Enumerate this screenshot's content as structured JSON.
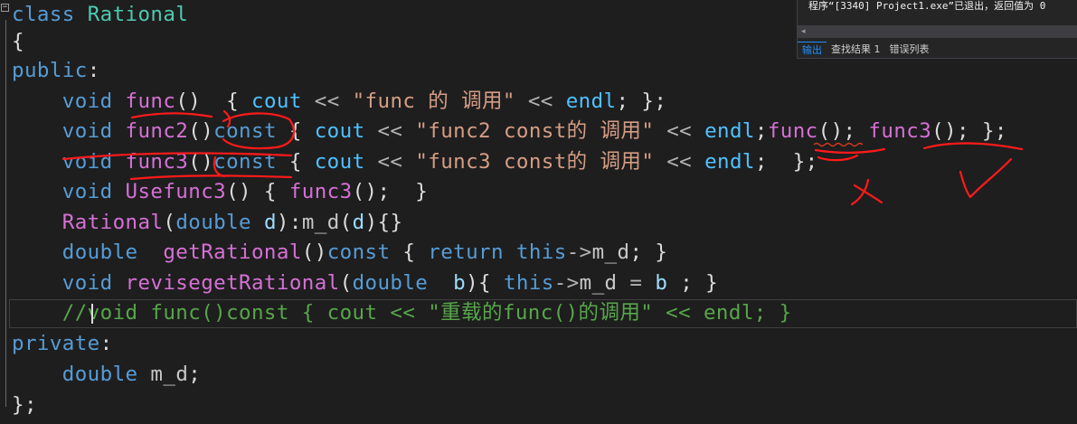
{
  "editor": {
    "lines": [
      [
        {
          "t": "class ",
          "c": "kw"
        },
        {
          "t": "Rational",
          "c": "cls"
        }
      ],
      [
        {
          "t": "{",
          "c": "pl"
        }
      ],
      [
        {
          "t": "public",
          "c": "kw"
        },
        {
          "t": ":",
          "c": "pl"
        }
      ],
      [
        {
          "t": "    void ",
          "c": "kw"
        },
        {
          "t": "func",
          "c": "fnm"
        },
        {
          "t": "()  ",
          "c": "pl"
        },
        {
          "t": "{ ",
          "c": "pl"
        },
        {
          "t": "cout",
          "c": "cout"
        },
        {
          "t": " << ",
          "c": "op"
        },
        {
          "t": "\"func 的 调用\"",
          "c": "str"
        },
        {
          "t": " << ",
          "c": "op"
        },
        {
          "t": "endl",
          "c": "endl"
        },
        {
          "t": "; };",
          "c": "pl"
        }
      ],
      [
        {
          "t": "    void ",
          "c": "kw"
        },
        {
          "t": "func2",
          "c": "fnm"
        },
        {
          "t": "()",
          "c": "pl"
        },
        {
          "t": "const",
          "c": "kw"
        },
        {
          "t": " { ",
          "c": "pl"
        },
        {
          "t": "cout",
          "c": "cout"
        },
        {
          "t": " << ",
          "c": "op"
        },
        {
          "t": "\"func2 const的 调用\"",
          "c": "str"
        },
        {
          "t": " << ",
          "c": "op"
        },
        {
          "t": "endl",
          "c": "endl"
        },
        {
          "t": ";",
          "c": "pl"
        },
        {
          "t": "func",
          "c": "fnm"
        },
        {
          "t": "(); ",
          "c": "pl"
        },
        {
          "t": "func3",
          "c": "fnm"
        },
        {
          "t": "(); };",
          "c": "pl"
        }
      ],
      [
        {
          "t": "    void ",
          "c": "kw"
        },
        {
          "t": "func3",
          "c": "fnm"
        },
        {
          "t": "()",
          "c": "pl"
        },
        {
          "t": "const",
          "c": "kw"
        },
        {
          "t": " { ",
          "c": "pl"
        },
        {
          "t": "cout",
          "c": "cout"
        },
        {
          "t": " << ",
          "c": "op"
        },
        {
          "t": "\"func3 const的 调用\"",
          "c": "str"
        },
        {
          "t": " << ",
          "c": "op"
        },
        {
          "t": "endl",
          "c": "endl"
        },
        {
          "t": ";  };",
          "c": "pl"
        }
      ],
      [
        {
          "t": "    void ",
          "c": "kw"
        },
        {
          "t": "Usefunc3",
          "c": "fnm"
        },
        {
          "t": "() { ",
          "c": "pl"
        },
        {
          "t": "func3",
          "c": "fnm"
        },
        {
          "t": "();  }",
          "c": "pl"
        }
      ],
      [
        {
          "t": "    ",
          "c": "pl"
        },
        {
          "t": "Rational",
          "c": "fnm"
        },
        {
          "t": "(",
          "c": "pl"
        },
        {
          "t": "double ",
          "c": "kw"
        },
        {
          "t": "d",
          "c": "par"
        },
        {
          "t": "):",
          "c": "pl"
        },
        {
          "t": "m_d",
          "c": "vr"
        },
        {
          "t": "(",
          "c": "pl"
        },
        {
          "t": "d",
          "c": "par"
        },
        {
          "t": "){}",
          "c": "pl"
        }
      ],
      [
        {
          "t": "    double  ",
          "c": "kw"
        },
        {
          "t": "getRational",
          "c": "fnm"
        },
        {
          "t": "()",
          "c": "pl"
        },
        {
          "t": "const",
          "c": "kw"
        },
        {
          "t": " { ",
          "c": "pl"
        },
        {
          "t": "return ",
          "c": "kw"
        },
        {
          "t": "this",
          "c": "kw"
        },
        {
          "t": "->",
          "c": "op"
        },
        {
          "t": "m_d",
          "c": "vr"
        },
        {
          "t": "; }",
          "c": "pl"
        }
      ],
      [
        {
          "t": "    void ",
          "c": "kw"
        },
        {
          "t": "revisegetRational",
          "c": "fnm"
        },
        {
          "t": "(",
          "c": "pl"
        },
        {
          "t": "double  ",
          "c": "kw"
        },
        {
          "t": "b",
          "c": "par"
        },
        {
          "t": "){ ",
          "c": "pl"
        },
        {
          "t": "this",
          "c": "kw"
        },
        {
          "t": "->",
          "c": "op"
        },
        {
          "t": "m_d",
          "c": "vr"
        },
        {
          "t": " = ",
          "c": "op"
        },
        {
          "t": "b",
          "c": "par"
        },
        {
          "t": " ; }",
          "c": "pl"
        }
      ],
      [
        {
          "t": "    //void func()const { cout << \"重载的func()的调用\" << endl; }",
          "c": "cmt"
        }
      ],
      [
        {
          "t": "private",
          "c": "kw"
        },
        {
          "t": ":",
          "c": "pl"
        }
      ],
      [
        {
          "t": "    double ",
          "c": "kw"
        },
        {
          "t": "m_d",
          "c": "vr"
        },
        {
          "t": ";",
          "c": "pl"
        }
      ],
      [
        {
          "t": "};",
          "c": "pl"
        }
      ]
    ]
  },
  "output_panel": {
    "message": "程序“[3340] Project1.exe”已退出，返回值为 0",
    "scroll_left_glyph": "◂",
    "tabs": [
      {
        "label": "输出",
        "active": true
      },
      {
        "label": "查找结果 1",
        "active": false
      },
      {
        "label": "错误列表",
        "active": false
      }
    ]
  },
  "colors": {
    "background": "#1e1e1e",
    "keyword": "#569cd6",
    "type_name": "#4ec9b0",
    "function": "#d670d6",
    "string": "#d69d85",
    "comment": "#57a64a",
    "annotation_ink": "#ff1a1a"
  },
  "fold_glyph": "−"
}
